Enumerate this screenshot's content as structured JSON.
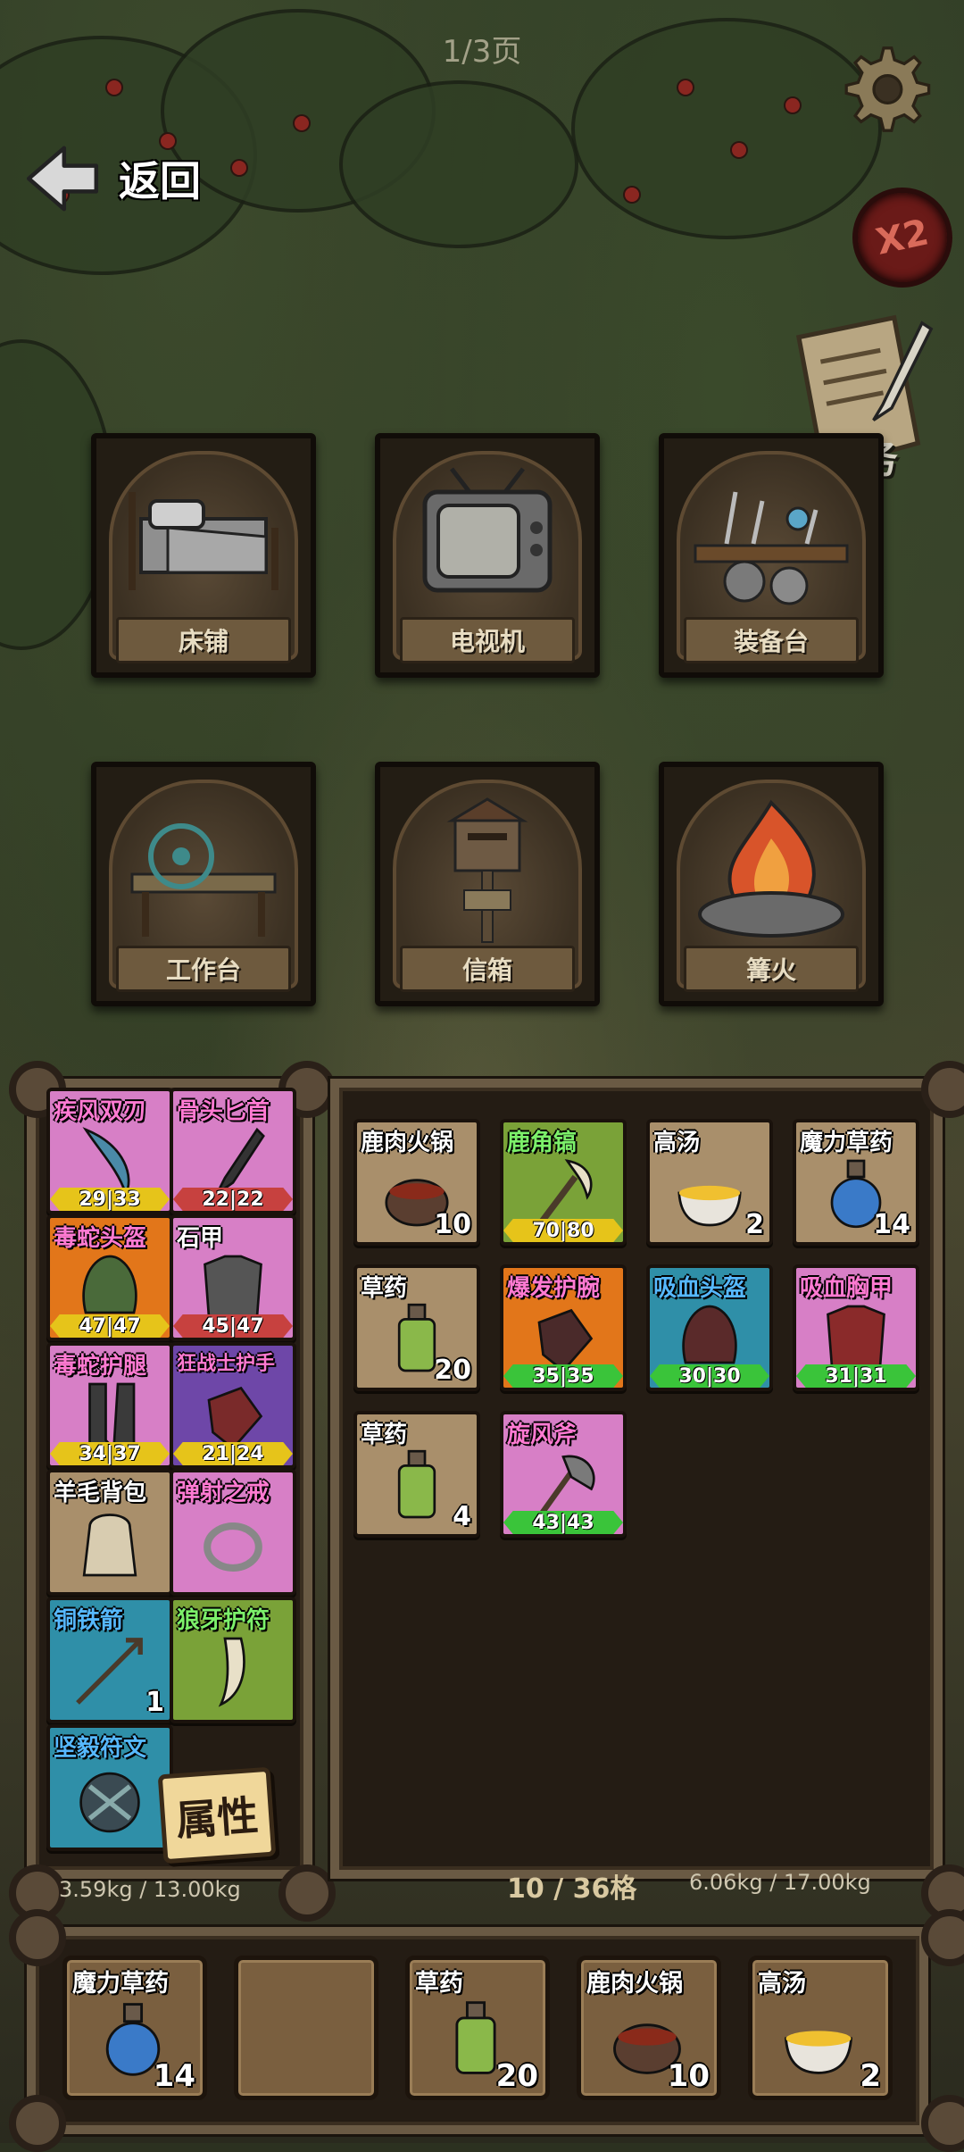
{
  "page_indicator": "1/3页",
  "back_label": "返回",
  "speed_label": "X2",
  "quest_label": "任务",
  "stations": [
    {
      "label": "床铺",
      "icon": "bed-icon"
    },
    {
      "label": "电视机",
      "icon": "tv-icon"
    },
    {
      "label": "装备台",
      "icon": "equipment-table-icon"
    },
    {
      "label": "工作台",
      "icon": "workbench-icon"
    },
    {
      "label": "信箱",
      "icon": "mailbox-icon"
    },
    {
      "label": "篝火",
      "icon": "campfire-icon"
    }
  ],
  "equipped": [
    {
      "name": "疾风双刃",
      "durability": "29|33",
      "color": "#d77fc6"
    },
    {
      "name": "骨头匕首",
      "durability": "22|22",
      "color": "#d77fc6"
    },
    {
      "name": "毒蛇头盔",
      "durability": "47|47",
      "color": "#e2761a"
    },
    {
      "name": "石甲",
      "durability": "45|47",
      "color": "#d77fc6"
    },
    {
      "name": "毒蛇护腿",
      "durability": "34|37",
      "color": "#d77fc6"
    },
    {
      "name": "狂战士护手",
      "durability": "21|24",
      "color": "#6e47a8"
    },
    {
      "name": "羊毛背包",
      "color": "#a98f6b"
    },
    {
      "name": "弹射之戒",
      "color": "#d77fc6"
    },
    {
      "name": "铜铁箭",
      "quantity": "1",
      "color": "#2f8fa8"
    },
    {
      "name": "狼牙护符",
      "color": "#7aa238"
    },
    {
      "name": "坚毅符文",
      "color": "#2f8fa8"
    }
  ],
  "attributes_label": "属性",
  "equipped_weight": "3.59kg / 13.00kg",
  "backpack": [
    {
      "name": "鹿肉火锅",
      "quantity": "10"
    },
    {
      "name": "鹿角镐",
      "durability": "70|80",
      "color": "#7aa238"
    },
    {
      "name": "高汤",
      "quantity": "2"
    },
    {
      "name": "魔力草药",
      "quantity": "14"
    },
    {
      "name": "草药",
      "quantity": "20"
    },
    {
      "name": "爆发护腕",
      "durability": "35|35",
      "color": "#e2761a"
    },
    {
      "name": "吸血头盔",
      "durability": "30|30",
      "color": "#2f8fa8"
    },
    {
      "name": "吸血胸甲",
      "durability": "31|31",
      "color": "#d77fc6"
    },
    {
      "name": "草药",
      "quantity": "4"
    },
    {
      "name": "旋风斧",
      "durability": "43|43",
      "color": "#d77fc6"
    }
  ],
  "backpack_capacity": "10 / 36格",
  "backpack_weight": "6.06kg / 17.00kg",
  "hotbar": [
    {
      "name": "魔力草药",
      "quantity": "14"
    },
    {
      "name": "",
      "quantity": ""
    },
    {
      "name": "草药",
      "quantity": "20"
    },
    {
      "name": "鹿肉火锅",
      "quantity": "10"
    },
    {
      "name": "高汤",
      "quantity": "2"
    }
  ]
}
